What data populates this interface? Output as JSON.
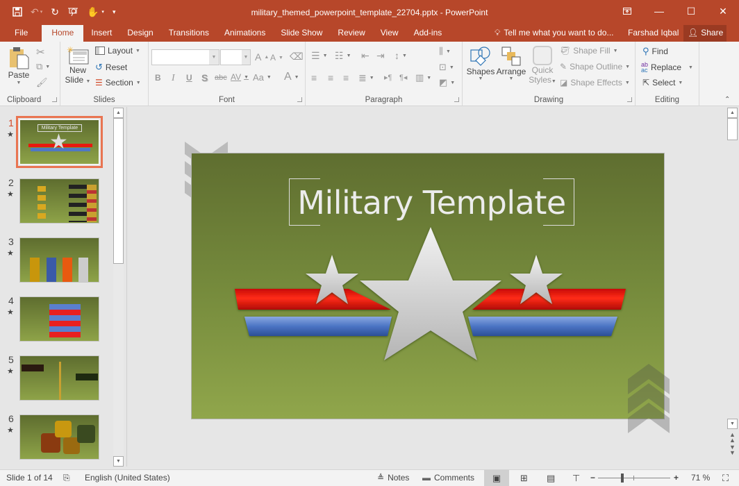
{
  "window": {
    "title": "military_themed_powerpoint_template_22704.pptx - PowerPoint",
    "quick_access": [
      "save-icon",
      "undo-icon",
      "redo-icon",
      "present-from-start-icon",
      "touch-mode-icon",
      "customize-qat-icon"
    ],
    "controls": [
      "ribbon-display-options-icon",
      "minimize-icon",
      "maximize-icon",
      "close-icon"
    ]
  },
  "tabs": [
    {
      "label": "File",
      "active": false
    },
    {
      "label": "Home",
      "active": true
    },
    {
      "label": "Insert",
      "active": false
    },
    {
      "label": "Design",
      "active": false
    },
    {
      "label": "Transitions",
      "active": false
    },
    {
      "label": "Animations",
      "active": false
    },
    {
      "label": "Slide Show",
      "active": false
    },
    {
      "label": "Review",
      "active": false
    },
    {
      "label": "View",
      "active": false
    },
    {
      "label": "Add-ins",
      "active": false
    }
  ],
  "tell_me": "Tell me what you want to do...",
  "user": "Farshad Iqbal",
  "share": "Share",
  "ribbon": {
    "clipboard": {
      "label": "Clipboard",
      "paste": "Paste"
    },
    "slides": {
      "label": "Slides",
      "new_slide_1": "New",
      "new_slide_2": "Slide",
      "layout": "Layout",
      "reset": "Reset",
      "section": "Section"
    },
    "font": {
      "label": "Font",
      "font_name": "",
      "font_size": "",
      "bold": "B",
      "italic": "I",
      "underline": "U",
      "shadow": "S",
      "strike": "abc",
      "spacing": "AV",
      "case": "Aa",
      "color": "A",
      "grow": "A",
      "shrink": "A"
    },
    "paragraph": {
      "label": "Paragraph"
    },
    "drawing": {
      "label": "Drawing",
      "shapes": "Shapes",
      "arrange": "Arrange",
      "quick_styles_1": "Quick",
      "quick_styles_2": "Styles",
      "shape_fill": "Shape Fill",
      "shape_outline": "Shape Outline",
      "shape_effects": "Shape Effects"
    },
    "editing": {
      "label": "Editing",
      "find": "Find",
      "replace": "Replace",
      "select": "Select"
    }
  },
  "thumbnails": [
    {
      "num": "1",
      "active": true,
      "caption": "Military Template"
    },
    {
      "num": "2",
      "active": false
    },
    {
      "num": "3",
      "active": false
    },
    {
      "num": "4",
      "active": false
    },
    {
      "num": "5",
      "active": false
    },
    {
      "num": "6",
      "active": false
    }
  ],
  "slide": {
    "title": "Military Template",
    "colors": {
      "bg_top": "#5f6e30",
      "bg_bottom": "#90a64b",
      "red": "#e8190f",
      "blue": "#4f78c4",
      "star": "#d8d8d8"
    }
  },
  "status": {
    "slide_info": "Slide 1 of 14",
    "language": "English (United States)",
    "notes": "Notes",
    "comments": "Comments",
    "zoom": "71 %",
    "zoom_value": 71
  },
  "accent": "#b7472a"
}
